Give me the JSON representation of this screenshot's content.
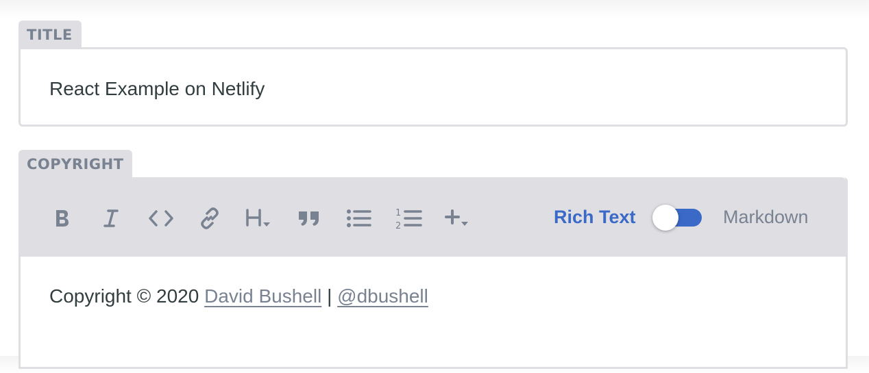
{
  "title_field": {
    "label": "TITLE",
    "value": "React Example on Netlify"
  },
  "copyright_field": {
    "label": "COPYRIGHT",
    "toolbar": {
      "buttons": [
        {
          "name": "bold",
          "icon": "bold-icon"
        },
        {
          "name": "italic",
          "icon": "italic-icon"
        },
        {
          "name": "code",
          "icon": "code-icon"
        },
        {
          "name": "link",
          "icon": "link-icon"
        },
        {
          "name": "heading",
          "icon": "heading-dropdown-icon"
        },
        {
          "name": "quote",
          "icon": "quote-icon"
        },
        {
          "name": "bulleted-list",
          "icon": "bulleted-list-icon"
        },
        {
          "name": "numbered-list",
          "icon": "numbered-list-icon"
        },
        {
          "name": "add",
          "icon": "plus-dropdown-icon"
        }
      ],
      "mode_toggle": {
        "left_label": "Rich Text",
        "right_label": "Markdown",
        "active": "Rich Text"
      }
    },
    "content": {
      "prefix": "Copyright © 2020",
      "link1": "David Bushell",
      "separator": "|",
      "link2": "@dbushell"
    }
  },
  "colors": {
    "accent": "#3a69c7",
    "label_bg": "#dfdfe3",
    "muted_text": "#798291",
    "body_text": "#313d3e"
  }
}
